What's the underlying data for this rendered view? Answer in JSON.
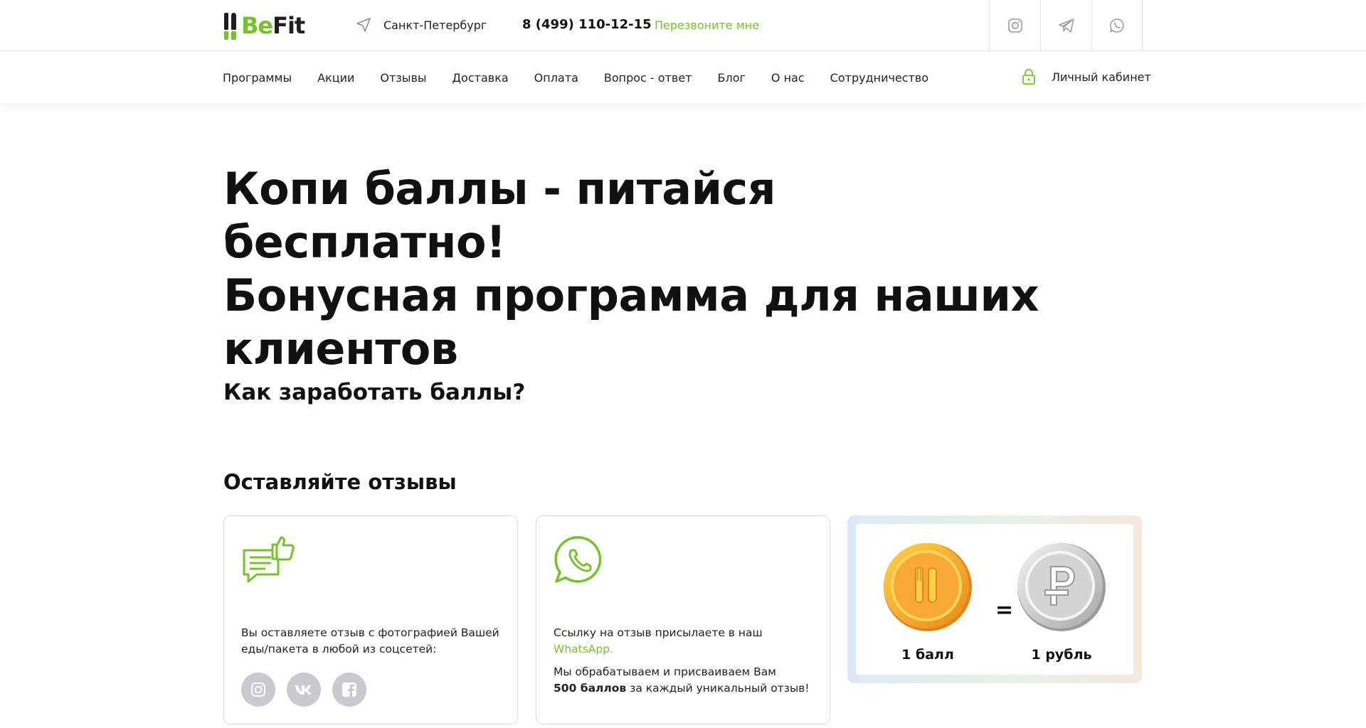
{
  "header": {
    "logo": {
      "part1": "Be",
      "part2": "Fit"
    },
    "city": "Санкт-Петербург",
    "phone": "8 (499) 110-12-15",
    "callback": "Перезвоните мне",
    "social_icons": [
      "instagram-icon",
      "telegram-icon",
      "whatsapp-icon"
    ]
  },
  "nav": {
    "items": [
      "Программы",
      "Акции",
      "Отзывы",
      "Доставка",
      "Оплата",
      "Вопрос - ответ",
      "Блог",
      "О нас",
      "Сотрудничество"
    ],
    "account": "Личный кабинет"
  },
  "hero": {
    "line1": "Копи баллы - питайся бесплатно!",
    "line2": "Бонусная программа для наших",
    "line3": "клиентов"
  },
  "section": {
    "how_title": "Как заработать баллы?",
    "reviews_title": "Оставляйте отзывы"
  },
  "card1": {
    "text": "Вы оставляете отзыв с фотографией Вашей еды/пакета в любой из соцсетей:",
    "socials": [
      "instagram-icon",
      "vk-icon",
      "facebook-icon"
    ]
  },
  "card2": {
    "text_prefix": "Ссылку на отзыв присылаете в наш ",
    "text_link": "WhatsApp.",
    "text2_line1": "Мы обрабатываем и присваиваем Вам",
    "text2_bold": "500 баллов",
    "text2_rest": " за каждый уникальный отзыв!"
  },
  "card3": {
    "left_label": "1 балл",
    "eq": "=",
    "right_label": "1 рубль"
  },
  "colors": {
    "accent": "#76c22b",
    "text": "#111111",
    "coin_gold": "#f2a82c",
    "coin_silver": "#c9c9c9"
  }
}
